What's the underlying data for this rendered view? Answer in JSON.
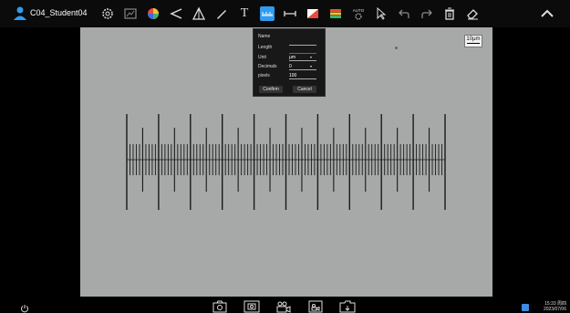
{
  "user": {
    "name": "C04_Student04"
  },
  "toolbar": {
    "tools": [
      "settings-icon",
      "frame-icon",
      "color-wheel-icon",
      "angle-icon",
      "triangle-icon",
      "pen-icon",
      "text-icon",
      "ruler-icon",
      "line-measure-icon",
      "color-box-icon",
      "color-bars-icon",
      "auto-icon",
      "select-icon",
      "undo-icon",
      "redo-icon",
      "trash-icon",
      "eraser-icon"
    ],
    "text_tool_label": "T",
    "auto_label": "AUTO",
    "active_tool": "ruler-icon",
    "accent_color": "#2f9cf0"
  },
  "viewer": {
    "scalebar_label": "10μm"
  },
  "dialog": {
    "name_label": "Name",
    "length_label": "Length",
    "unit_label": "Unit",
    "unit_value": "μm",
    "decimals_label": "Decimals",
    "decimals_value": "0",
    "pixels_label": "pixels",
    "pixels_value": "100",
    "confirm_label": "Confirm",
    "cancel_label": "Cancel"
  },
  "status": {
    "time": "15:33 周四",
    "date": "2023/07/06"
  }
}
